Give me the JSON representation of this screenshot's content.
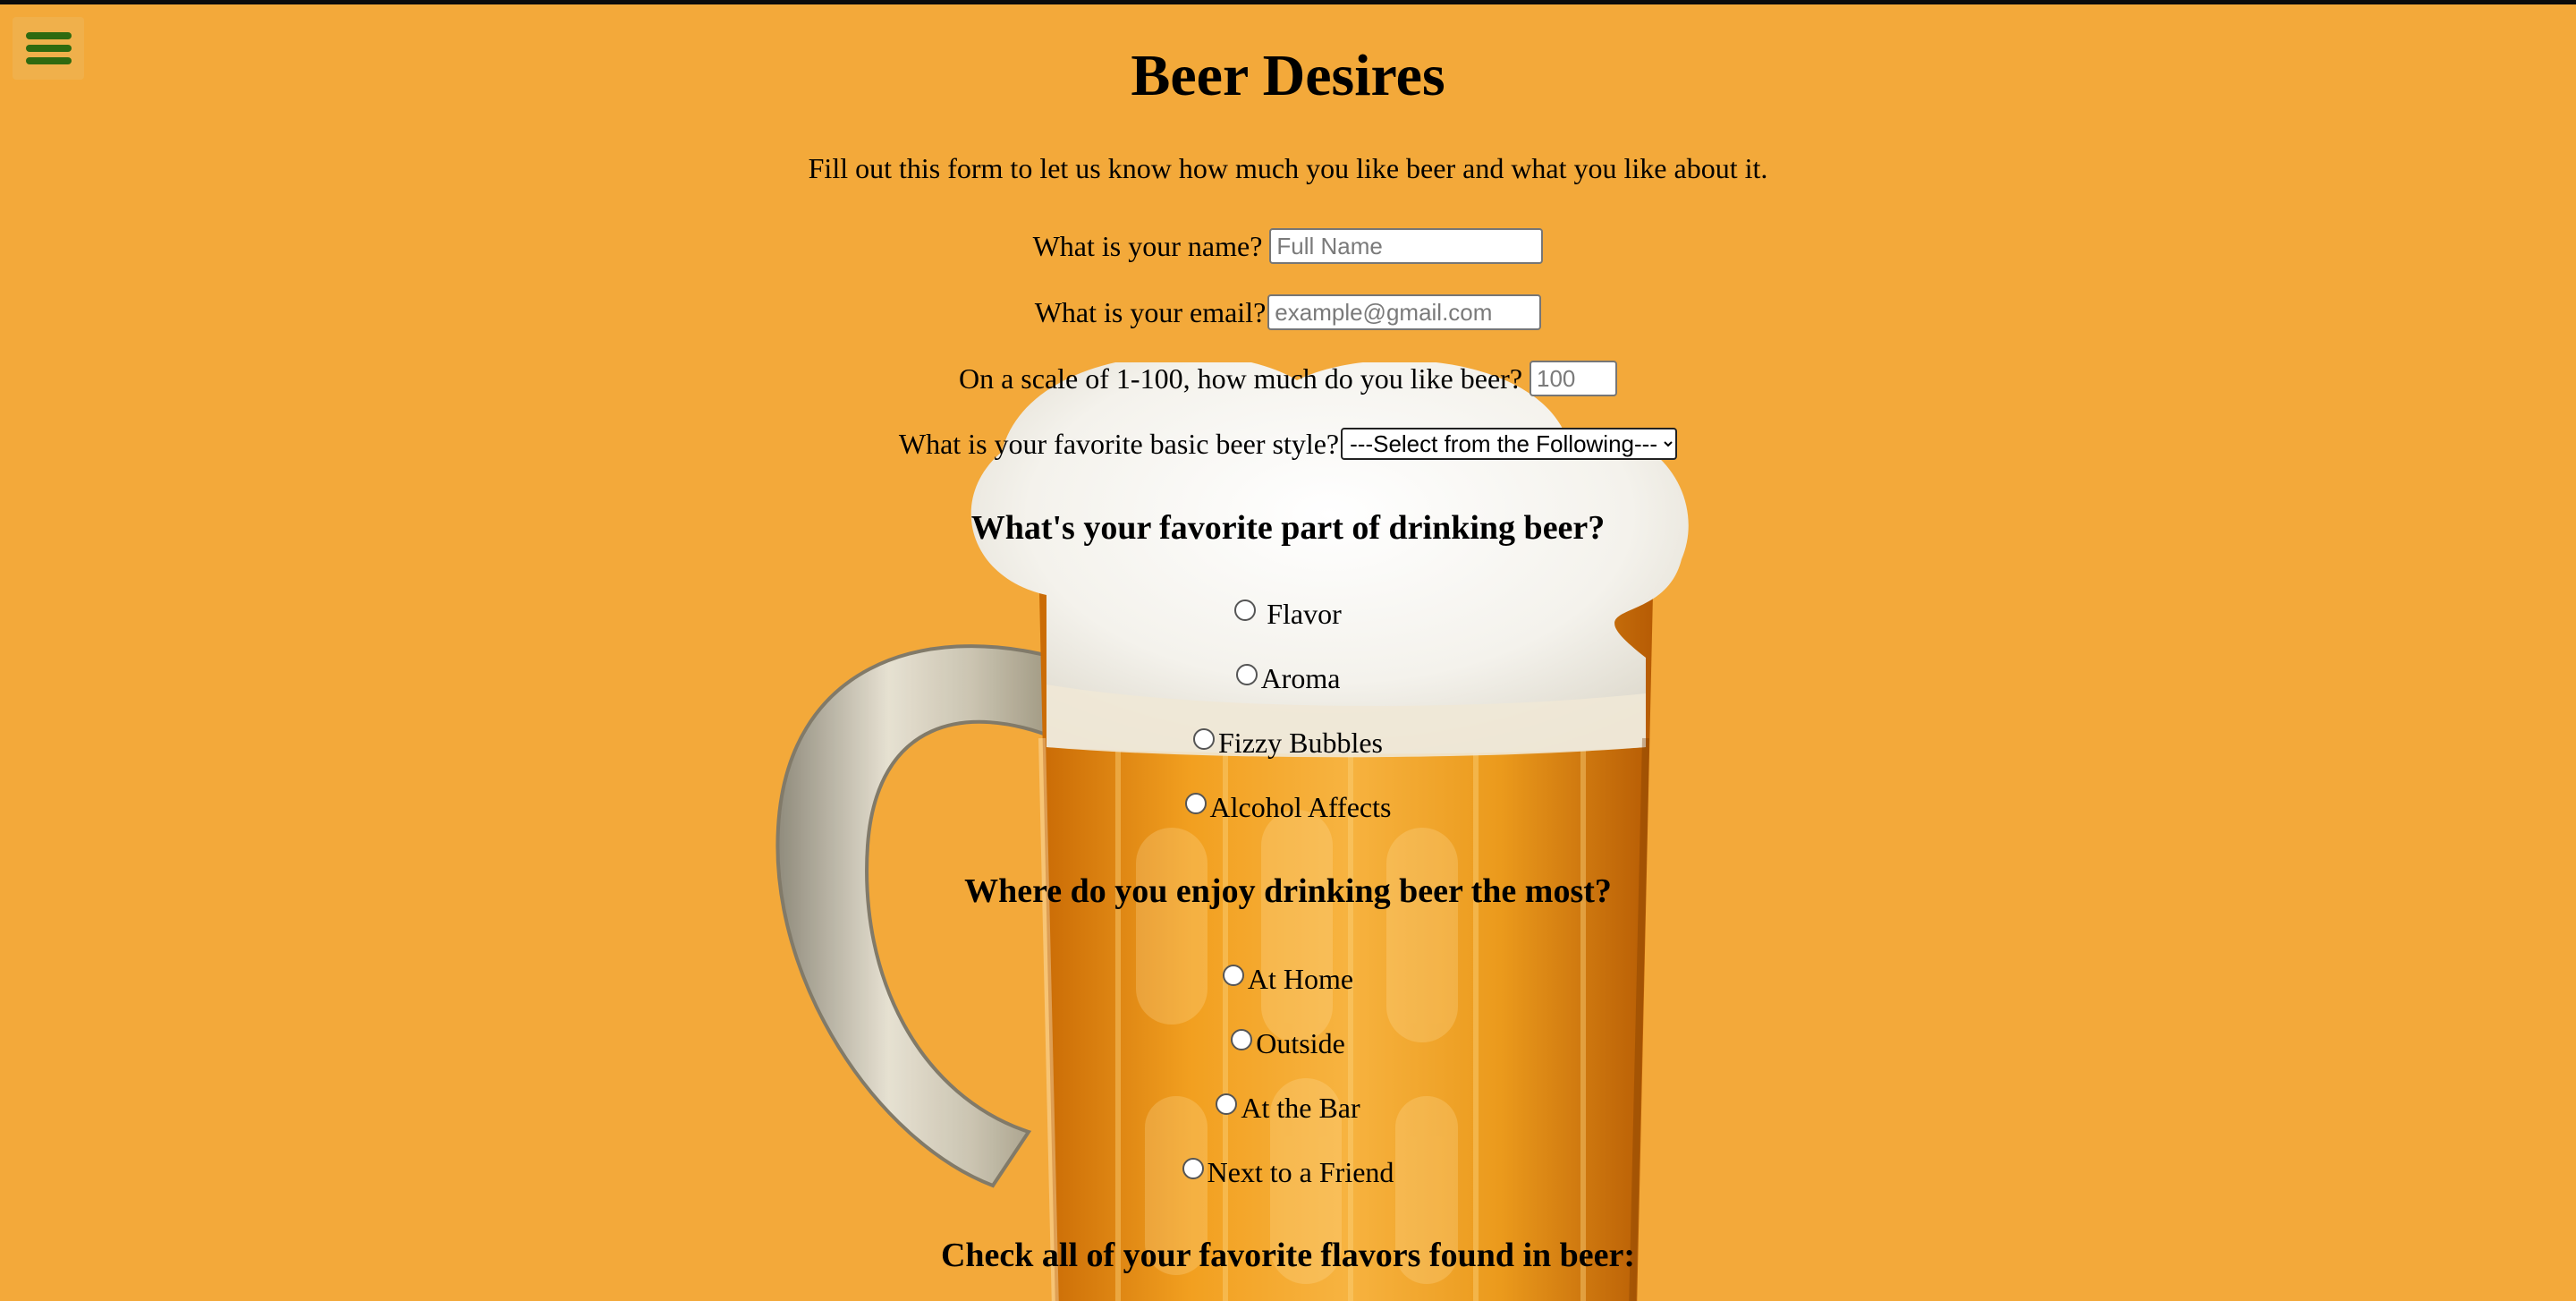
{
  "page": {
    "title": "Beer Desires",
    "intro": "Fill out this form to let us know how much you like beer and what you like about it."
  },
  "menu": {
    "icon": "hamburger-menu-icon"
  },
  "form": {
    "name": {
      "label": "What is your name?",
      "placeholder": "Full Name",
      "value": ""
    },
    "email": {
      "label": "What is your email?",
      "placeholder": "example@gmail.com",
      "value": ""
    },
    "rating": {
      "label": "On a scale of 1-100, how much do you like beer?",
      "placeholder": "100",
      "value": ""
    },
    "style": {
      "label": "What is your favorite basic beer style?",
      "selected": "---Select from the Following---"
    }
  },
  "favorite_part": {
    "heading": "What's your favorite part of drinking beer?",
    "options": [
      "Flavor",
      "Aroma",
      "Fizzy Bubbles",
      "Alcohol Affects"
    ]
  },
  "location": {
    "heading": "Where do you enjoy drinking beer the most?",
    "options": [
      "At Home",
      "Outside",
      "At the Bar",
      "Next to a Friend"
    ]
  },
  "flavors": {
    "heading": "Check all of your favorite flavors found in beer:"
  },
  "colors": {
    "background": "#f3a93a",
    "menu_bars": "#2f6a10"
  }
}
